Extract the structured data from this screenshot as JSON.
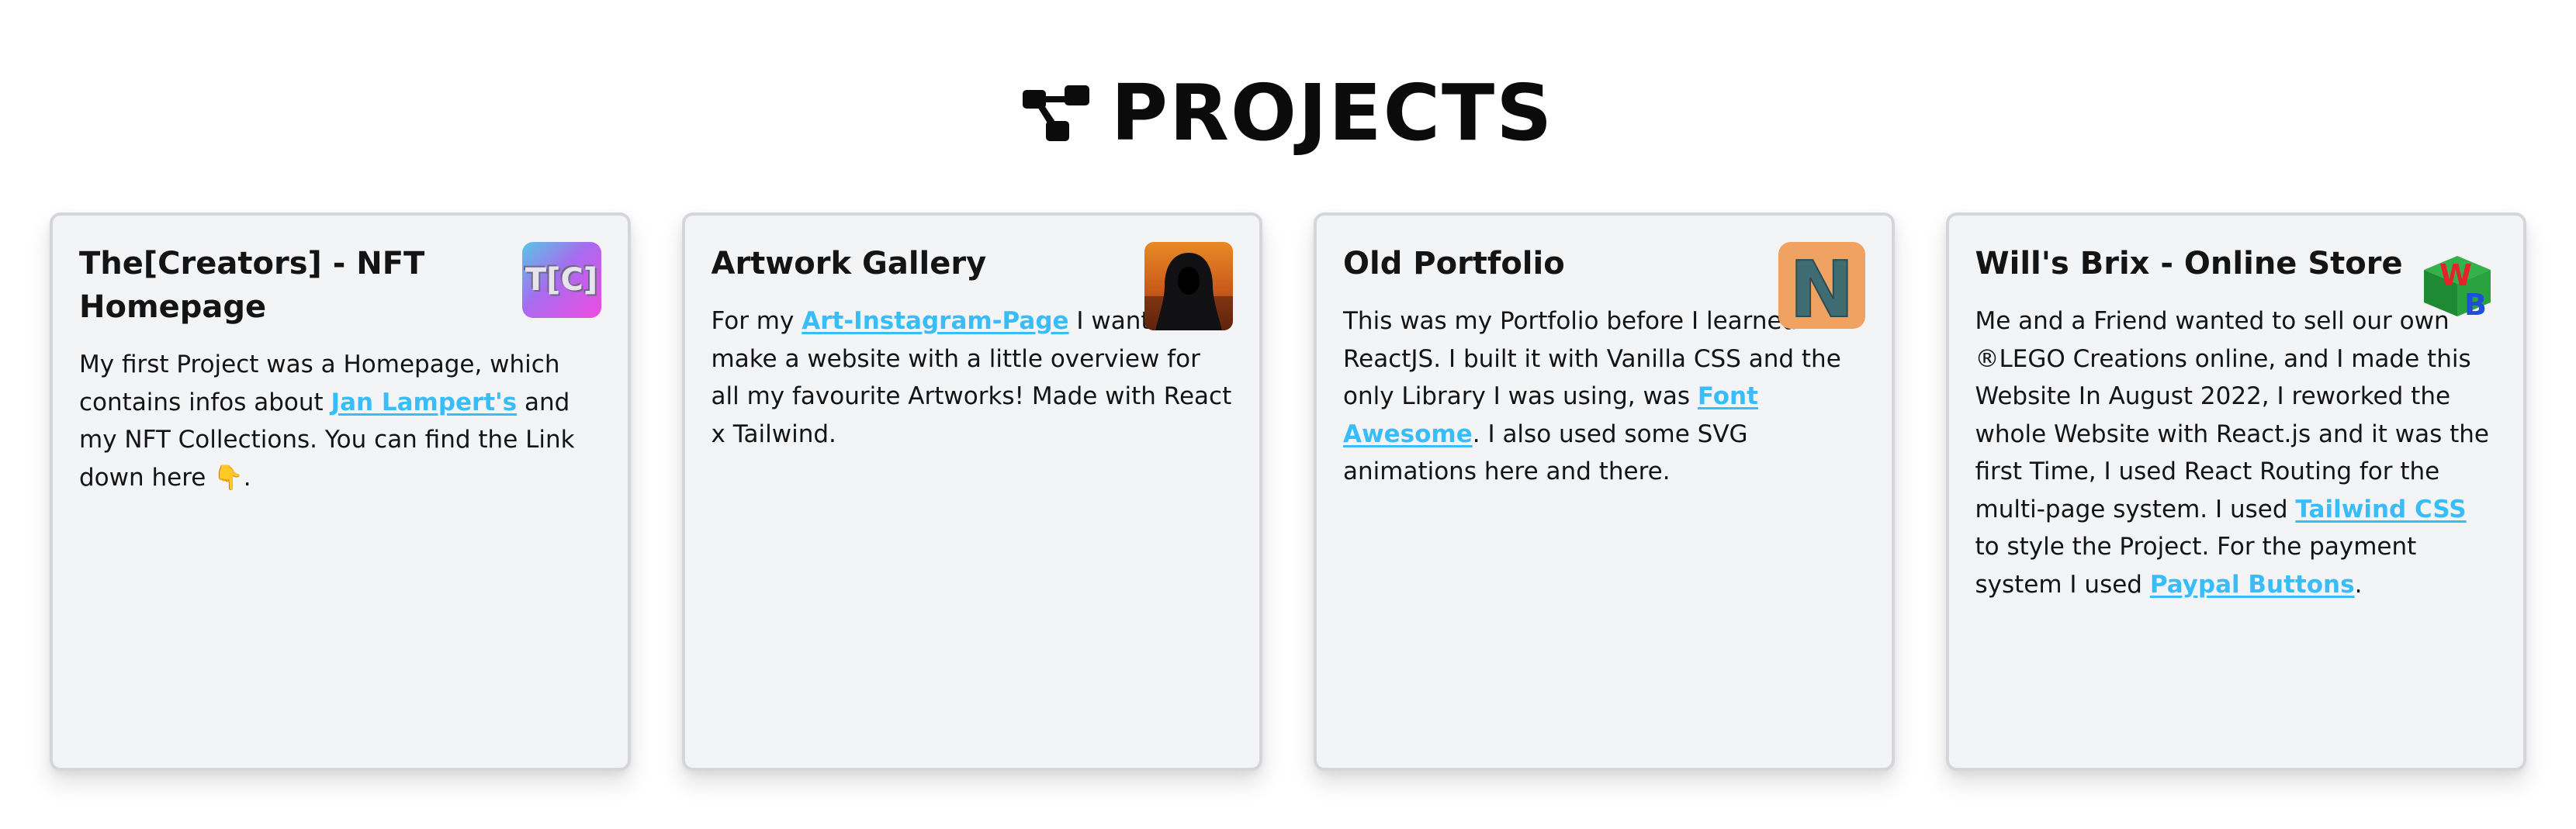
{
  "header": {
    "icon": "diagram-project-icon",
    "title": "PROJECTS"
  },
  "cards": [
    {
      "title": "The[Creators] - NFT Homepage",
      "logo": {
        "icon": "tc-logo-icon",
        "text": "T[C]"
      },
      "desc": {
        "p1": "My first Project was a Homepage, which contains infos about ",
        "link1": "Jan Lampert's",
        "p2": " and my NFT Collections. You can find the Link down here 👇."
      }
    },
    {
      "title": "Artwork Gallery",
      "logo": {
        "icon": "hooded-figure-icon"
      },
      "desc": {
        "p1": "For my ",
        "link1": "Art-Instagram-Page",
        "p2": " I wanted to make a website with a little overview for all my favourite Artworks! Made with React x Tailwind."
      }
    },
    {
      "title": "Old Portfolio",
      "logo": {
        "icon": "n-logo-icon",
        "text": "N"
      },
      "desc": {
        "p1": "This was my Portfolio before I learned ReactJS. I built it with Vanilla CSS and the only Library I was using, was ",
        "link1": "Font Awesome",
        "p2": ". I also used some SVG animations here and there."
      }
    },
    {
      "title": "Will's Brix - Online Store",
      "logo": {
        "icon": "wb-cube-logo-icon",
        "text": "WB"
      },
      "desc": {
        "p1": "Me and a Friend wanted to sell our own ®LEGO Creations online, and I made this Website In August 2022, I reworked the whole Website with React.js and it was the first Time, I used React Routing for the multi-page system. I used ",
        "link1": "Tailwind CSS",
        "p2": " to style the Project. For the payment system I used ",
        "link2": "Paypal Buttons",
        "p3": "."
      }
    }
  ],
  "colors": {
    "link": "#38bdf8",
    "card_bg": "#f3f4f6",
    "card_border": "#d4d6db",
    "title": "#0b0b0b"
  }
}
